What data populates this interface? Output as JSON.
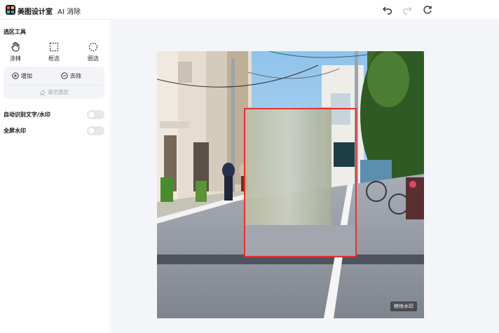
{
  "app": {
    "brand": "美图设计室",
    "tool_name": "AI 消除"
  },
  "toolbar": {
    "undo_icon": "undo-icon",
    "redo_icon": "redo-icon",
    "reset_icon": "refresh-icon"
  },
  "sidebar": {
    "section_title": "选区工具",
    "modes": [
      {
        "label": "涂抹",
        "icon": "brush-hand-icon",
        "active": true
      },
      {
        "label": "框选",
        "icon": "rect-select-icon",
        "active": false
      },
      {
        "label": "圈选",
        "icon": "lasso-select-icon",
        "active": false
      }
    ],
    "add_label": "增加",
    "remove_label": "去除",
    "clear_label": "清空选区",
    "options": [
      {
        "label": "自动识别文字/水印",
        "enabled": false
      },
      {
        "label": "全屏水印",
        "enabled": false
      }
    ]
  },
  "canvas": {
    "watermark_button": "移除水印"
  },
  "colors": {
    "selection": "#e53030",
    "accent": "#111111",
    "toggle_off": "#e6e7eb"
  }
}
